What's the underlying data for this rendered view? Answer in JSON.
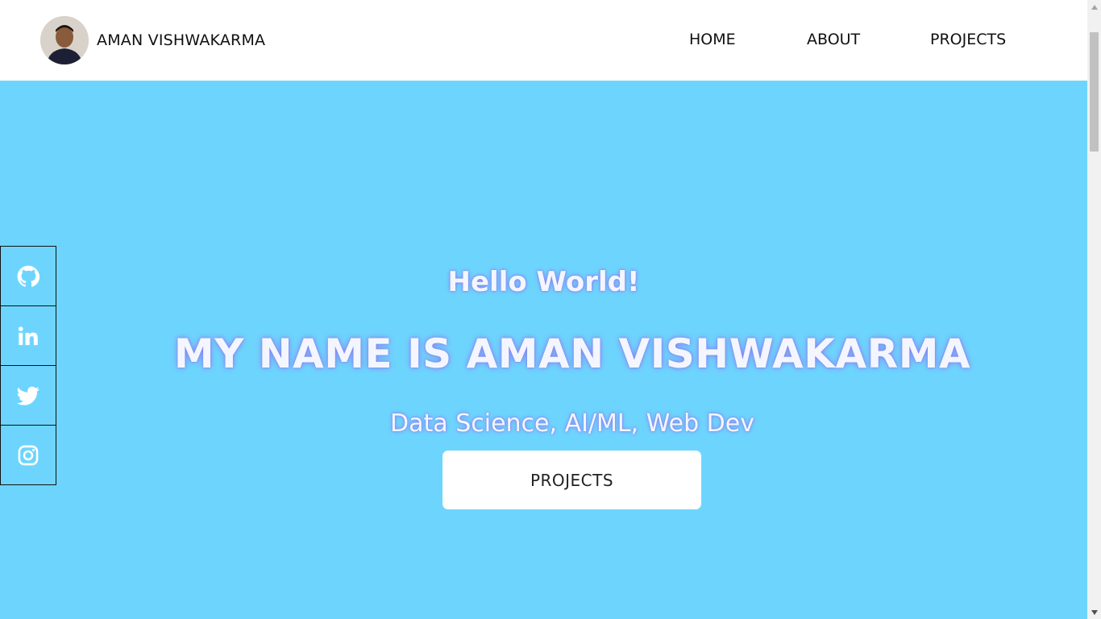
{
  "header": {
    "brand_name": "AMAN VISHWAKARMA",
    "nav": [
      {
        "label": "HOME"
      },
      {
        "label": "ABOUT"
      },
      {
        "label": "PROJECTS"
      }
    ]
  },
  "hero": {
    "greeting": "Hello World!",
    "headline": "MY NAME IS AMAN VISHWAKARMA",
    "tagline": "Data Science, AI/ML, Web Dev",
    "cta_label": "PROJECTS"
  },
  "social": [
    {
      "icon": "github-icon"
    },
    {
      "icon": "linkedin-icon"
    },
    {
      "icon": "twitter-icon"
    },
    {
      "icon": "instagram-icon"
    }
  ],
  "colors": {
    "background": "#6dd5fd",
    "header": "#ffffff",
    "text_glow": "#8a7cf0"
  }
}
